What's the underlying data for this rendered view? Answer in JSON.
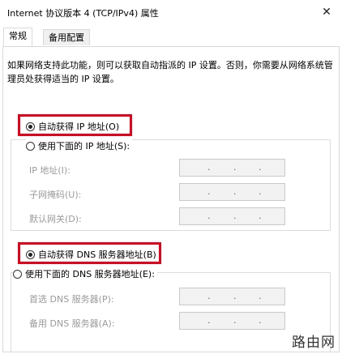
{
  "window": {
    "title": "Internet 协议版本 4 (TCP/IPv4) 属性",
    "close_symbol": "✕"
  },
  "tabs": [
    {
      "label": "常规",
      "active": true
    },
    {
      "label": "备用配置",
      "active": false
    }
  ],
  "description": "如果网络支持此功能，则可以获取自动指派的 IP 设置。否则，你需要从网络系统管理员处获得适当的 IP 设置。",
  "ip_section": {
    "auto_option": {
      "label": "自动获得 IP 地址(O)",
      "checked": true
    },
    "manual_option": {
      "label": "使用下面的 IP 地址(S):",
      "checked": false
    },
    "fields": [
      {
        "label": "IP 地址(I):",
        "value": ". . ."
      },
      {
        "label": "子网掩码(U):",
        "value": ". . ."
      },
      {
        "label": "默认网关(D):",
        "value": ". . ."
      }
    ]
  },
  "dns_section": {
    "auto_option": {
      "label": "自动获得 DNS 服务器地址(B)",
      "checked": true
    },
    "manual_option": {
      "label": "使用下面的 DNS 服务器地址(E):",
      "checked": false
    },
    "fields": [
      {
        "label": "首选 DNS 服务器(P):",
        "value": ". . ."
      },
      {
        "label": "备用 DNS 服务器(A):",
        "value": ". . ."
      }
    ]
  },
  "watermark": "路由网",
  "colors": {
    "highlight": "#e8001a",
    "disabled_text": "#9a9a9a",
    "field_bg": "#f2f2f2"
  }
}
